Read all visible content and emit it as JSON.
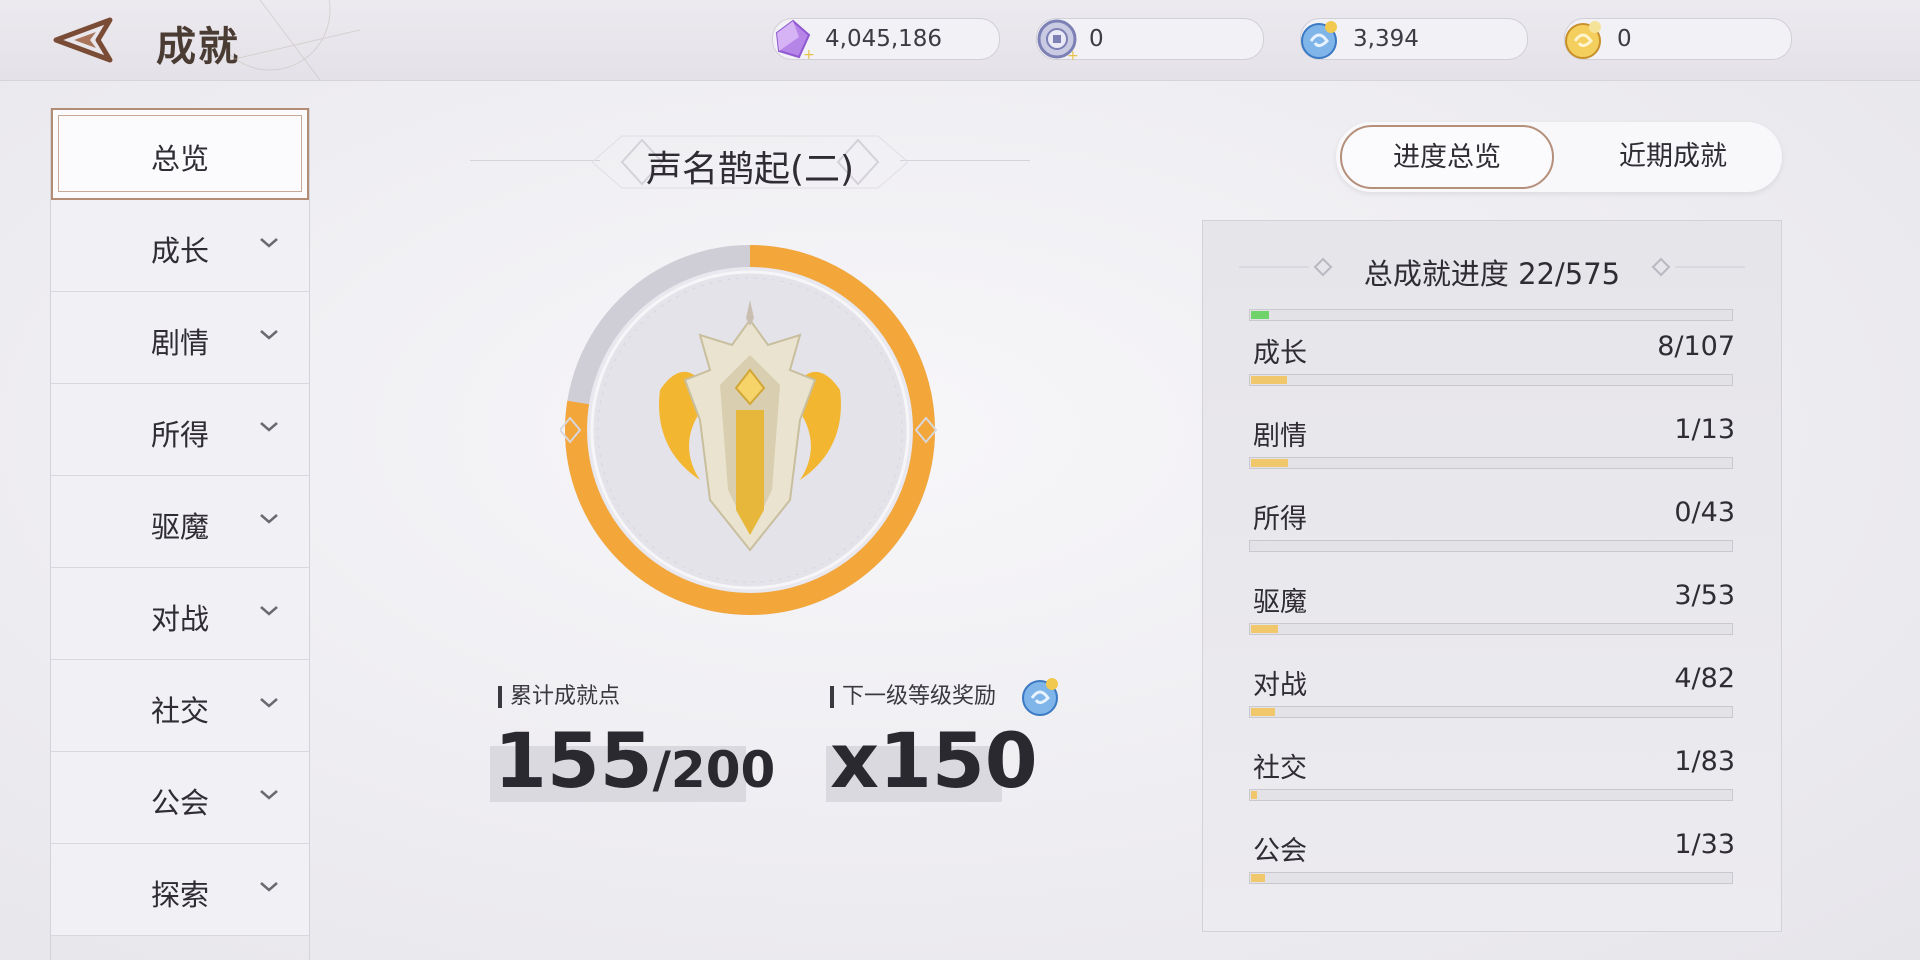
{
  "header": {
    "title": "成就",
    "currencies": [
      {
        "icon": "purple-crystal-icon",
        "value": "4,045,186"
      },
      {
        "icon": "silver-coin-icon",
        "value": "0"
      },
      {
        "icon": "blue-orb-icon",
        "value": "3,394"
      },
      {
        "icon": "gold-orb-icon",
        "value": "0"
      }
    ]
  },
  "sidebar": {
    "items": [
      {
        "label": "总览"
      },
      {
        "label": "成长"
      },
      {
        "label": "剧情"
      },
      {
        "label": "所得"
      },
      {
        "label": "驱魔"
      },
      {
        "label": "对战"
      },
      {
        "label": "社交"
      },
      {
        "label": "公会"
      },
      {
        "label": "探索"
      }
    ]
  },
  "center": {
    "rank_title": "声名鹊起(二)",
    "ring_progress": 0.775,
    "points_label": "累计成就点",
    "points_current": "155",
    "points_total": "/200",
    "reward_label": "下一级等级奖励",
    "reward_icon": "blue-orb-icon",
    "reward_value": "x150"
  },
  "tabs": {
    "overview": "进度总览",
    "recent": "近期成就"
  },
  "progress": {
    "title": "总成就进度 22/575",
    "total_fraction": 0.038,
    "rows": [
      {
        "name": "成长",
        "value": "8/107",
        "fraction": 0.075
      },
      {
        "name": "剧情",
        "value": "1/13",
        "fraction": 0.077
      },
      {
        "name": "所得",
        "value": "0/43",
        "fraction": 0
      },
      {
        "name": "驱魔",
        "value": "3/53",
        "fraction": 0.057
      },
      {
        "name": "对战",
        "value": "4/82",
        "fraction": 0.049
      },
      {
        "name": "社交",
        "value": "1/83",
        "fraction": 0.012
      },
      {
        "name": "公会",
        "value": "1/33",
        "fraction": 0.03
      }
    ]
  },
  "colors": {
    "accent_orange": "#f3a63a",
    "accent_green": "#6fd36b",
    "row_fill": "#f0c76a",
    "frame_brown": "#b48f7a"
  }
}
